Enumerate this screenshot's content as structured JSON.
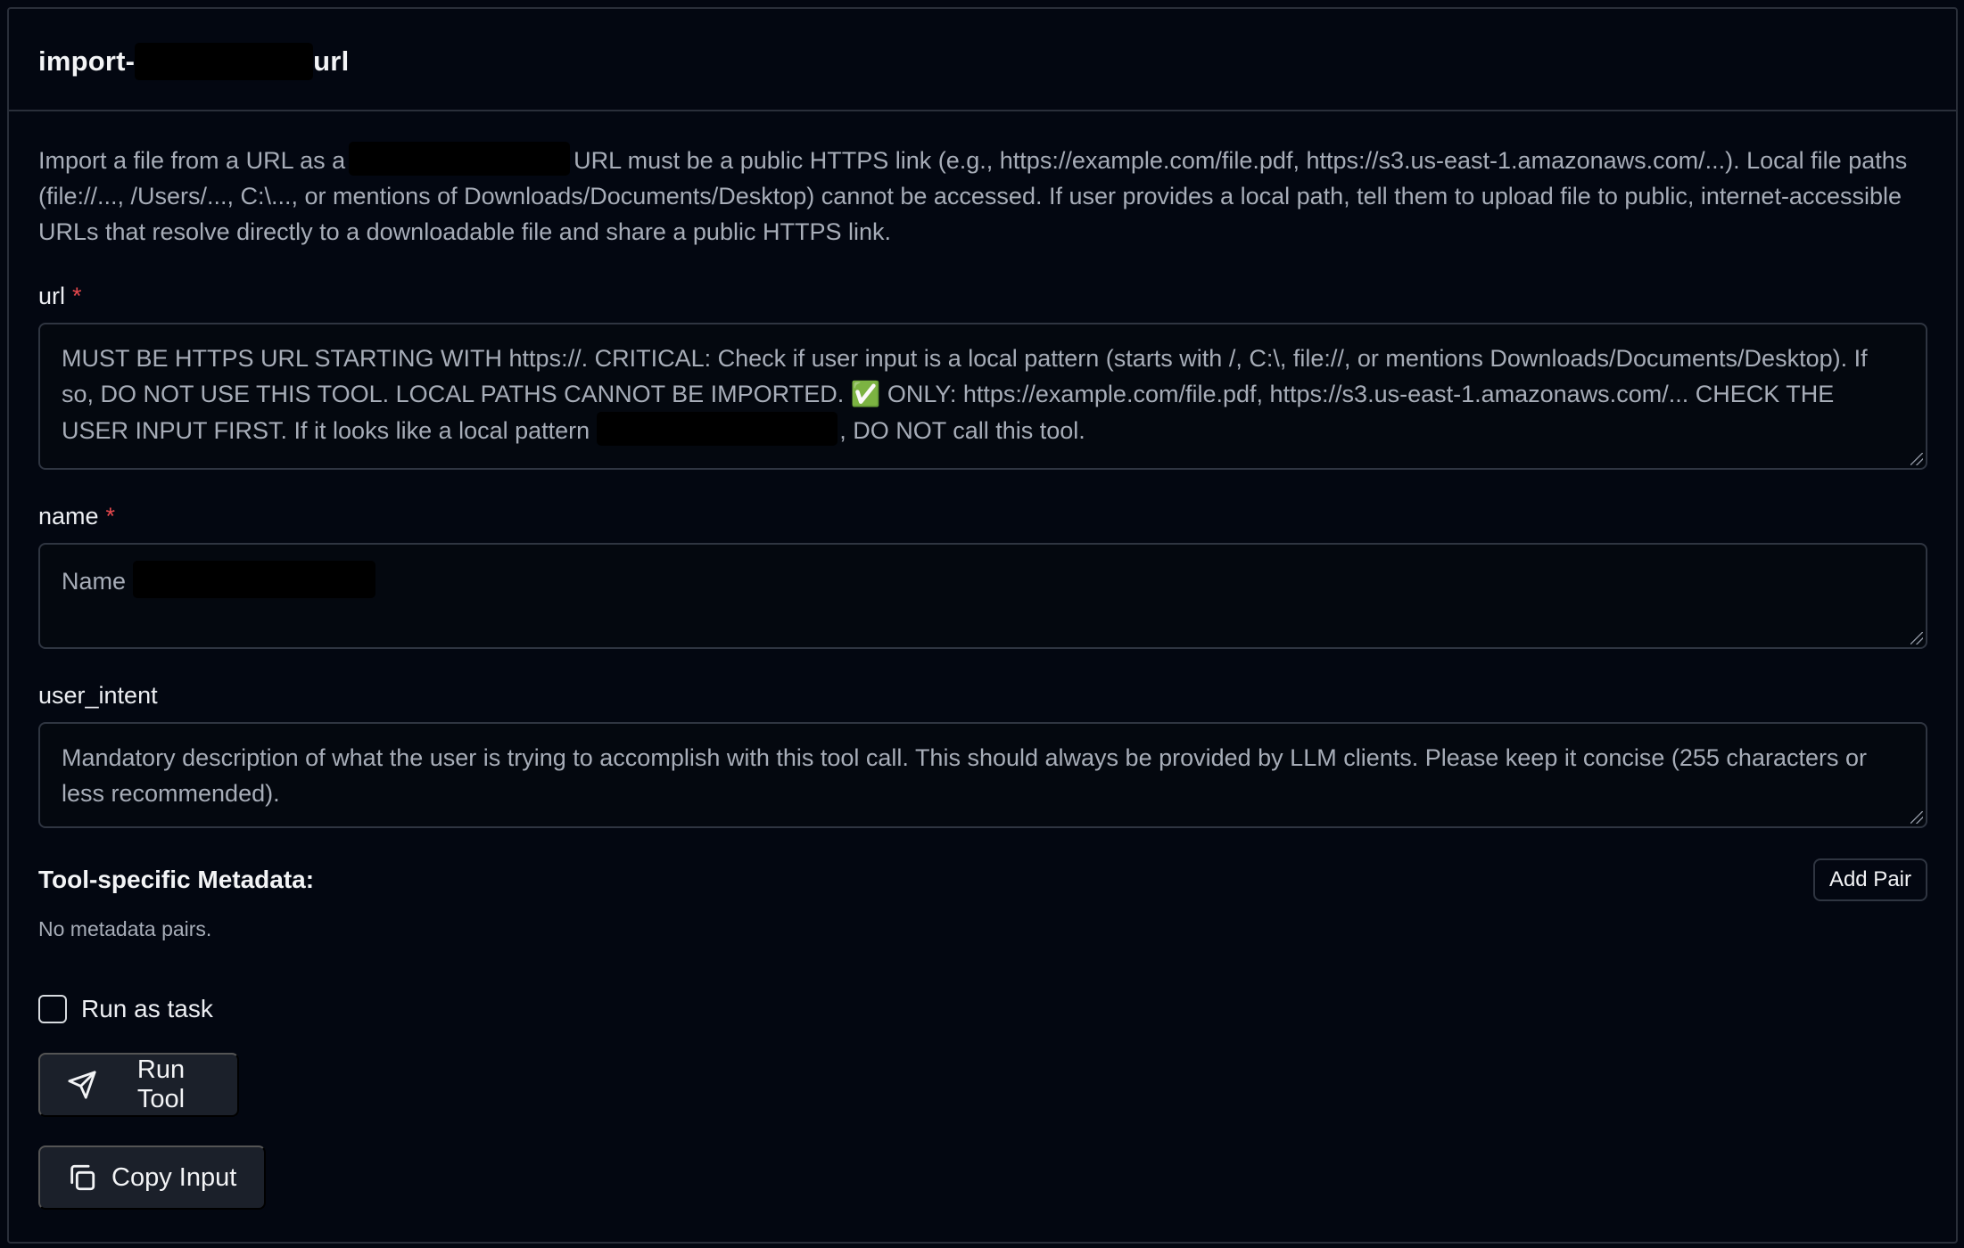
{
  "tool": {
    "title_prefix": "import-",
    "title_suffix": "url",
    "description_part1": "Import a file from a URL as a",
    "description_part2": "URL must be a public HTTPS link (e.g., https://example.com/file.pdf, https://s3.us-east-1.amazonaws.com/...). Local file paths (file://..., /Users/..., C:\\..., or mentions of Downloads/Documents/Desktop) cannot be accessed. If user provides a local path, tell them to upload file to public, internet-accessible URLs that resolve directly to a downloadable file and share a public HTTPS link."
  },
  "fields": {
    "url": {
      "label": "url",
      "required_mark": "*",
      "placeholder_part1": "MUST BE HTTPS URL STARTING WITH https://. CRITICAL: Check if user input is a local pattern (starts with /, C:\\, file://, or mentions Downloads/Documents/Desktop). If so, DO NOT USE THIS TOOL. LOCAL PATHS CANNOT BE IMPORTED. ✅ ONLY: https://example.com/file.pdf, https://s3.us-east-1.amazonaws.com/... CHECK THE USER INPUT FIRST. If it looks like a local pattern",
      "placeholder_part2": ", DO NOT call this tool."
    },
    "name": {
      "label": "name",
      "required_mark": "*",
      "placeholder": "Name"
    },
    "user_intent": {
      "label": "user_intent",
      "placeholder": "Mandatory description of what the user is trying to accomplish with this tool call. This should always be provided by LLM clients. Please keep it concise (255 characters or less recommended)."
    }
  },
  "metadata": {
    "title": "Tool-specific Metadata:",
    "add_pair_label": "Add Pair",
    "empty_text": "No metadata pairs."
  },
  "options": {
    "run_as_task_label": "Run as task",
    "run_as_task_checked": false
  },
  "actions": {
    "run_tool_label": "Run Tool",
    "copy_input_label": "Copy Input"
  },
  "icons": {
    "run": "send-icon",
    "copy": "copy-icon"
  },
  "colors": {
    "background": "#030711",
    "border": "#2a2f3a",
    "required": "#e5484d",
    "button_bg": "#1b202a"
  }
}
